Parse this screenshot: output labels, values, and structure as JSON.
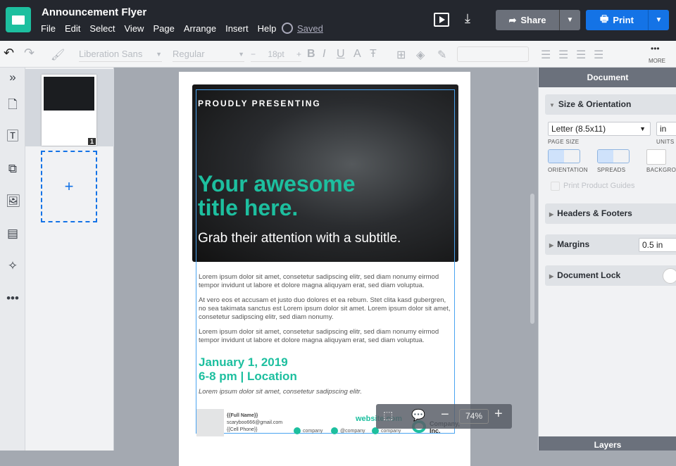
{
  "app": {
    "title": "Announcement Flyer",
    "menu": [
      "File",
      "Edit",
      "Select",
      "View",
      "Page",
      "Arrange",
      "Insert",
      "Help"
    ],
    "saved": "Saved",
    "share": "Share",
    "print": "Print",
    "brand_color": "#1dbf9f",
    "accent": "#1473e6"
  },
  "toolbar": {
    "font": "Liberation Sans",
    "weight": "Regular",
    "size": "18pt",
    "minus": "−",
    "plus": "+",
    "bold": "B",
    "italic": "I",
    "underline": "U",
    "color": "A",
    "more": "MORE"
  },
  "pages": {
    "page_number": "1",
    "add": "+"
  },
  "flyer": {
    "kicker": "PROUDLY PRESENTING",
    "title": "Your awesome title here.",
    "subtitle": "Grab their attention with a subtitle.",
    "paragraphs": [
      "Lorem ipsum dolor sit amet, consetetur sadipscing elitr, sed diam nonumy eirmod tempor invidunt ut labore et dolore magna aliquyam erat, sed diam voluptua.",
      "At vero eos et accusam et justo duo dolores et ea rebum. Stet clita kasd gubergren, no sea takimata sanctus est Lorem ipsum dolor sit amet. Lorem ipsum dolor sit amet, consetetur sadipscing elitr, sed diam nonumy.",
      "Lorem ipsum dolor sit amet, consetetur sadipscing elitr, sed diam nonumy eirmod tempor invidunt ut labore et dolore magna aliquyam erat, sed diam voluptua."
    ],
    "date": "January 1, 2019",
    "time": "6-8 pm | Location",
    "italic": "Lorem ipsum dolor sit amet, consetetur sadipscing elitr.",
    "name": "{{Full Name}}",
    "email": "scaryboo666@gmail.com",
    "phone": "{{Cell Phone}}",
    "website": "website.com",
    "social": [
      "company",
      "@company",
      "company"
    ],
    "company": "Company, Inc."
  },
  "zoom": {
    "value": "74%",
    "minus": "−",
    "plus": "+"
  },
  "panel": {
    "header": "Document",
    "size_orientation": "Size & Orientation",
    "page_size": "Letter (8.5x11)",
    "page_size_label": "PAGE SIZE",
    "units": "in",
    "units_label": "UNITS",
    "orientation_label": "ORIENTATION",
    "spreads_label": "SPREADS",
    "background_label": "BACKGROUND",
    "print_guides": "Print Product Guides",
    "headers_footers": "Headers & Footers",
    "margins": "Margins",
    "margins_value": "0.5 in",
    "document_lock": "Document Lock",
    "layers": "Layers"
  }
}
